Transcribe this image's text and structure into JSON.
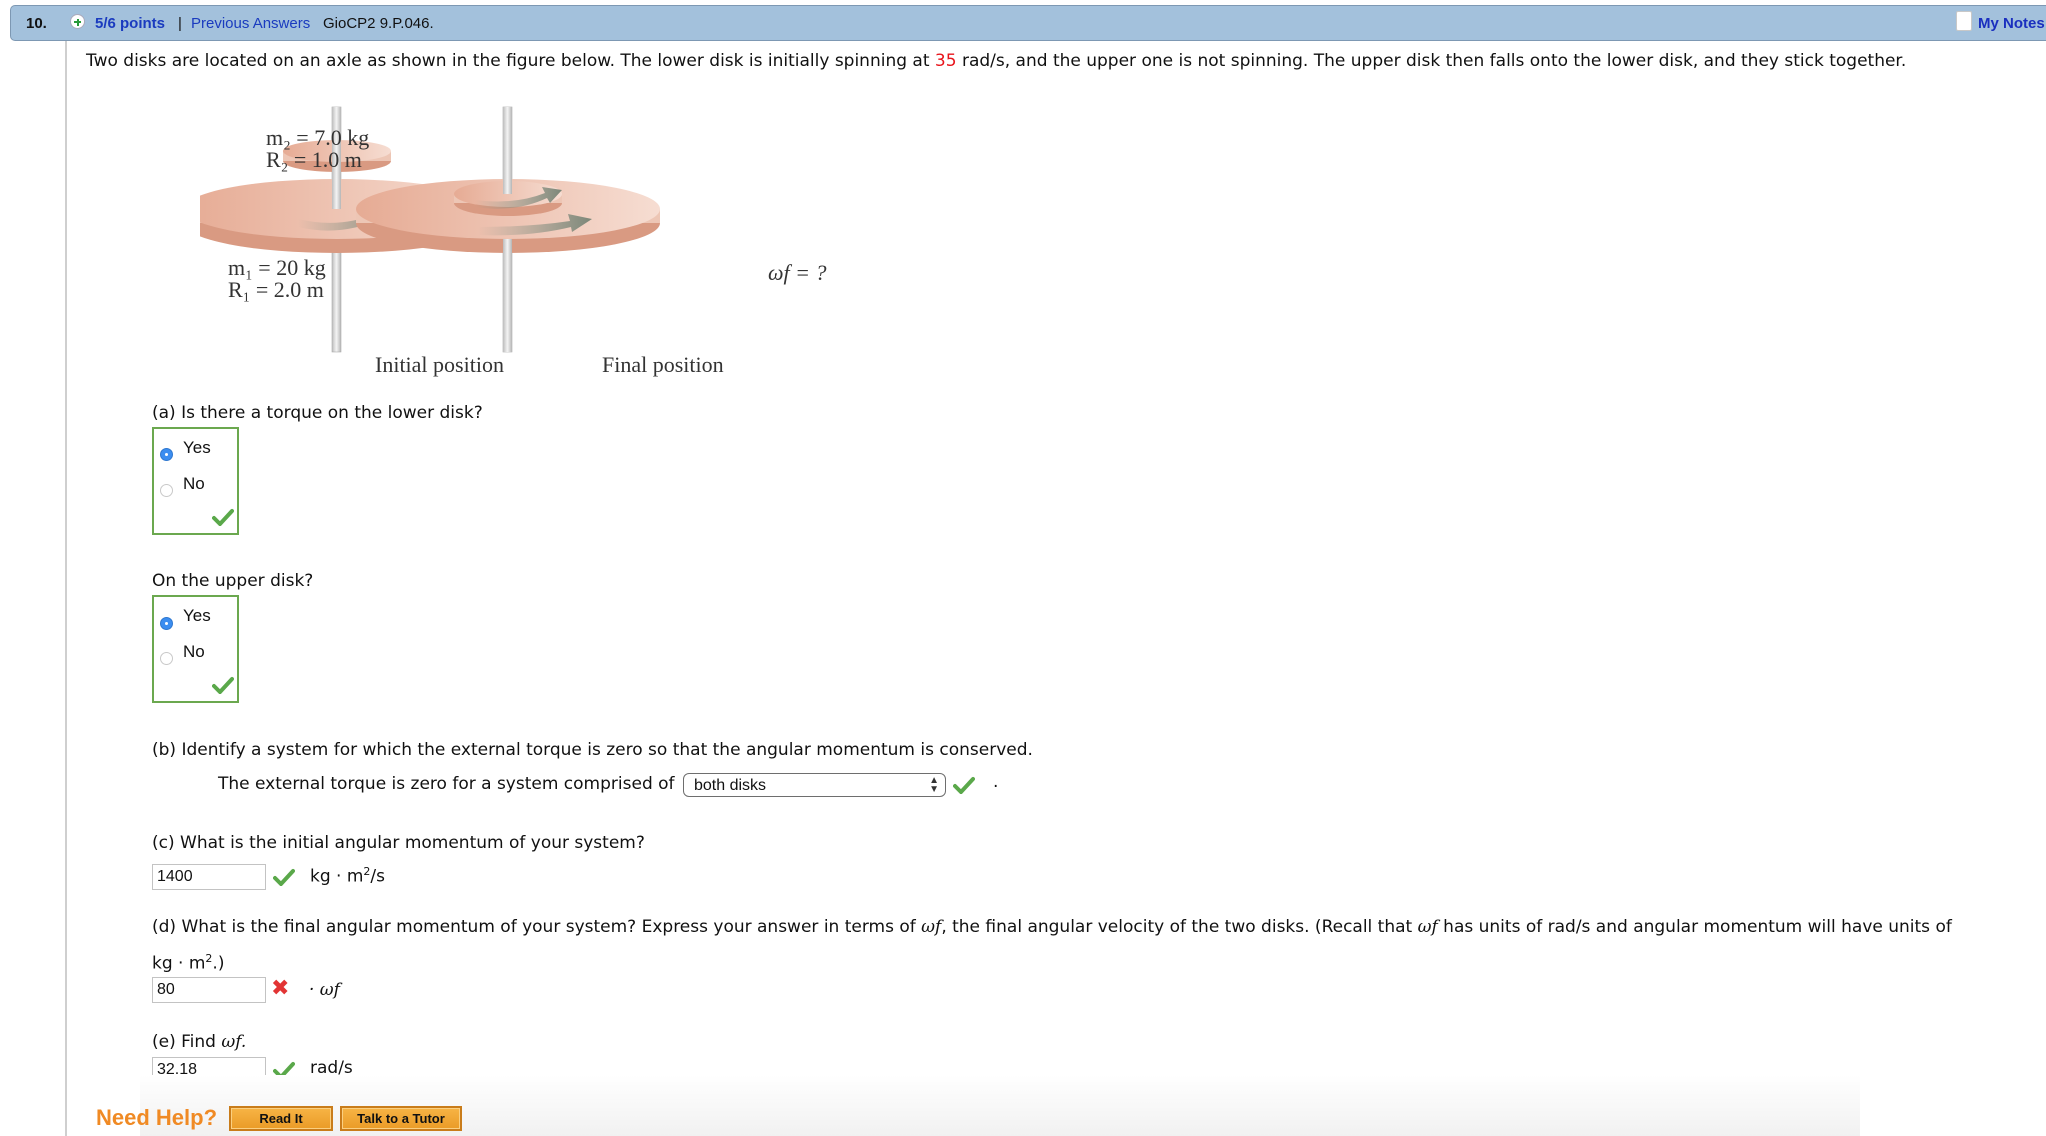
{
  "header": {
    "question_number": "10.",
    "status_icon": "plus-circle-icon",
    "points": "5/6 points",
    "separator": "|",
    "previous_answers": "Previous Answers",
    "problem_code": "GioCP2 9.P.046.",
    "my_notes": "My Notes"
  },
  "problem": {
    "text_before": "Two disks are located on an axle as shown in the figure below. The lower disk is initially spinning at ",
    "highlight_value": "35",
    "text_after": " rad/s, and the upper one is not spinning. The upper disk then falls onto the lower disk, and they stick together."
  },
  "figure": {
    "upper_disk_mass": "m₂ = 7.0 kg",
    "upper_disk_radius": "R₂ = 1.0 m",
    "lower_disk_mass": "m₁ = 20 kg",
    "lower_disk_radius": "R₁ = 2.0 m",
    "omega_label": "ωf = ?",
    "initial_caption": "Initial position",
    "final_caption": "Final position",
    "colors": {
      "disk": "#e8b4a0",
      "axle": "#d8d8d8",
      "arrow": "#8a9486"
    }
  },
  "part_a": {
    "question": "(a) Is there a torque on the lower disk?",
    "options": [
      {
        "label": "Yes",
        "selected": true
      },
      {
        "label": "No",
        "selected": false
      }
    ],
    "result": "correct"
  },
  "part_a2": {
    "question": "On the upper disk?",
    "options": [
      {
        "label": "Yes",
        "selected": true
      },
      {
        "label": "No",
        "selected": false
      }
    ],
    "result": "correct"
  },
  "part_b": {
    "question": "(b) Identify a system for which the external torque is zero so that the angular momentum is conserved.",
    "prompt": "The external torque is zero for a system comprised of",
    "selected": "both disks",
    "trailing": ".",
    "result": "correct"
  },
  "part_c": {
    "question": "(c) What is the initial angular momentum of your system?",
    "value": "1400",
    "units_prefix": "kg · m",
    "units_exp": "2",
    "units_suffix": "/s",
    "result": "correct"
  },
  "part_d": {
    "question_line1_a": "(d) What is the final angular momentum of your system? Express your answer in terms of ",
    "omega": "ωf",
    "question_line1_b": ", the final angular velocity of the two disks. (Recall that ",
    "question_line1_c": " has units of rad/s and angular momentum will have units of",
    "question_line2_prefix": "kg · m",
    "question_line2_exp": "2",
    "question_line2_suffix": ".)",
    "value": "80",
    "suffix": "· ωf",
    "result": "incorrect"
  },
  "part_e": {
    "question_prefix": "(e) Find ",
    "omega": "ωf.",
    "value": "32.18",
    "units": "rad/s",
    "result": "correct"
  },
  "help": {
    "label": "Need Help?",
    "read_it": "Read It",
    "talk_to_tutor": "Talk to a Tutor",
    "accent": "#f08a24"
  },
  "colors": {
    "header_bg": "#a3c1dc",
    "link": "#1a3bbf",
    "correct": "#5aa84a",
    "incorrect": "#e23434",
    "highlight": "#e8141b"
  }
}
